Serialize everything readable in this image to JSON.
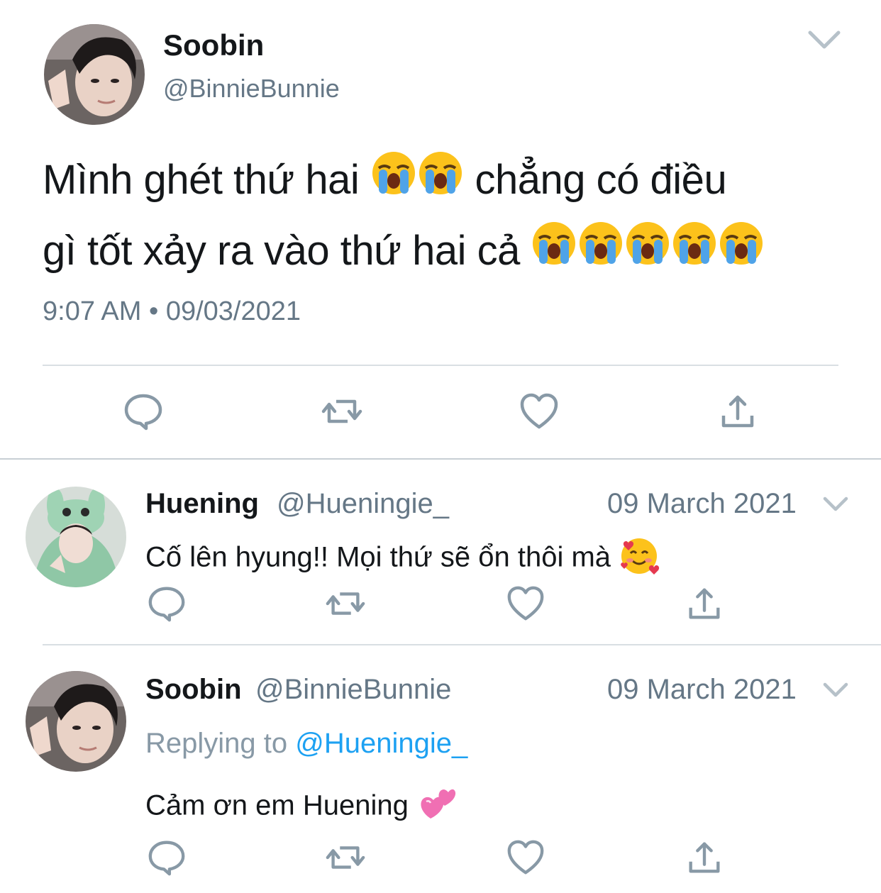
{
  "main_tweet": {
    "display_name": "Soobin",
    "handle": "@BinnieBunnie",
    "text_line1": "Mình ghét thứ hai",
    "text_line1b": "chẳng có điều",
    "text_line2": "gì tốt xảy ra vào thứ hai cả",
    "timestamp": "9:07 AM • 09/03/2021",
    "avatar_icon": "avatar-photo-icon"
  },
  "replies": [
    {
      "display_name": "Huening",
      "handle": "@Hueningie_",
      "date": "09 March 2021",
      "text": "Cố lên hyung!! Mọi thứ sẽ ổn thôi mà",
      "emoji_icon": "smiling-face-with-hearts-icon"
    },
    {
      "display_name": "Soobin",
      "handle": "@BinnieBunnie",
      "date": "09 March 2021",
      "replying_prefix": "Replying to",
      "replying_handle": "@Hueningie_",
      "text": "Cảm ơn em Huening",
      "emoji_icon": "revolving-hearts-icon"
    }
  ],
  "colors": {
    "text": "#14171a",
    "secondary": "#657786",
    "icon": "#8899a6",
    "link": "#1da1f2"
  }
}
